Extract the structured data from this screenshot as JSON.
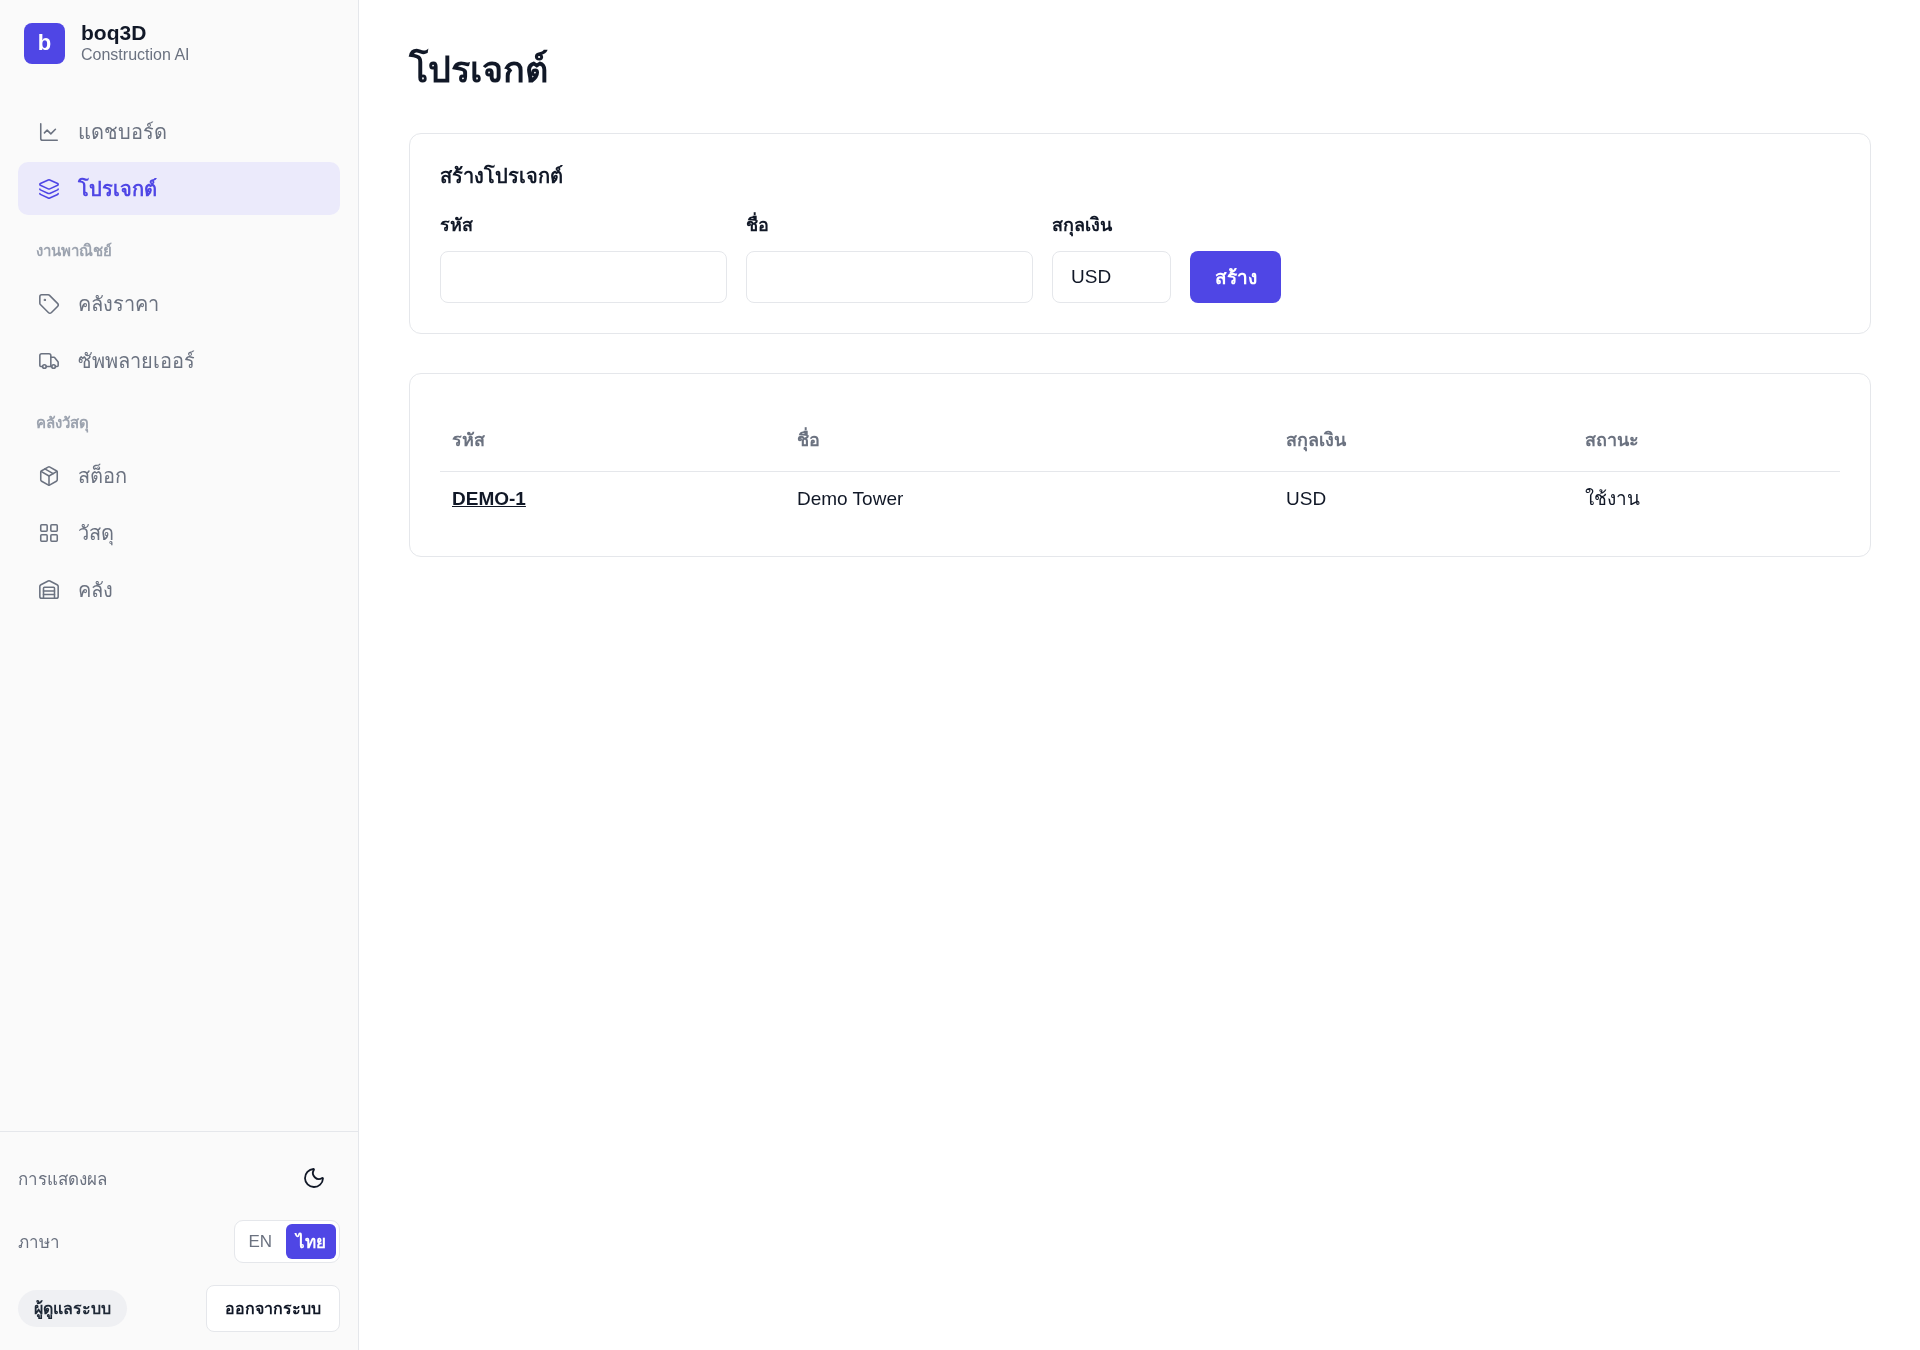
{
  "sidebar": {
    "brand": {
      "logo_letter": "b",
      "name": "boq3D",
      "tagline": "Construction AI"
    },
    "nav_groups": [
      {
        "items": [
          {
            "label": "แดชบอร์ด",
            "selected": false
          },
          {
            "label": "โปรเจกต์",
            "selected": true
          }
        ]
      },
      {
        "heading": "งานพาณิชย์",
        "items": [
          {
            "label": "คลังราคา",
            "selected": false
          },
          {
            "label": "ซัพพลายเออร์",
            "selected": false
          }
        ]
      },
      {
        "heading": "คลังวัสดุ",
        "items": [
          {
            "label": "สต็อก",
            "selected": false
          },
          {
            "label": "วัสดุ",
            "selected": false
          },
          {
            "label": "คลัง",
            "selected": false
          }
        ]
      }
    ],
    "display": {
      "label": "การแสดงผล"
    },
    "language": {
      "label": "ภาษา",
      "options": [
        {
          "label": "EN",
          "selected": false
        },
        {
          "label": "ไทย",
          "selected": true
        }
      ]
    },
    "role_badge": "ผู้ดูแลระบบ",
    "logout_button": "ออกจากระบบ"
  },
  "page_title": "โปรเจกต์",
  "create_form": {
    "title": "สร้างโปรเจกต์",
    "fields": [
      {
        "label": "รหัส"
      },
      {
        "label": "ชื่อ"
      },
      {
        "label": "สกุลเงิน",
        "value": "USD"
      }
    ],
    "submit_button": "สร้าง"
  },
  "table": {
    "columns": [
      "รหัส",
      "ชื่อ",
      "สกุลเงิน",
      "สถานะ"
    ],
    "rows": [
      {
        "cells": [
          "DEMO-1",
          "Demo Tower",
          "USD",
          "ใช้งาน"
        ]
      }
    ]
  }
}
